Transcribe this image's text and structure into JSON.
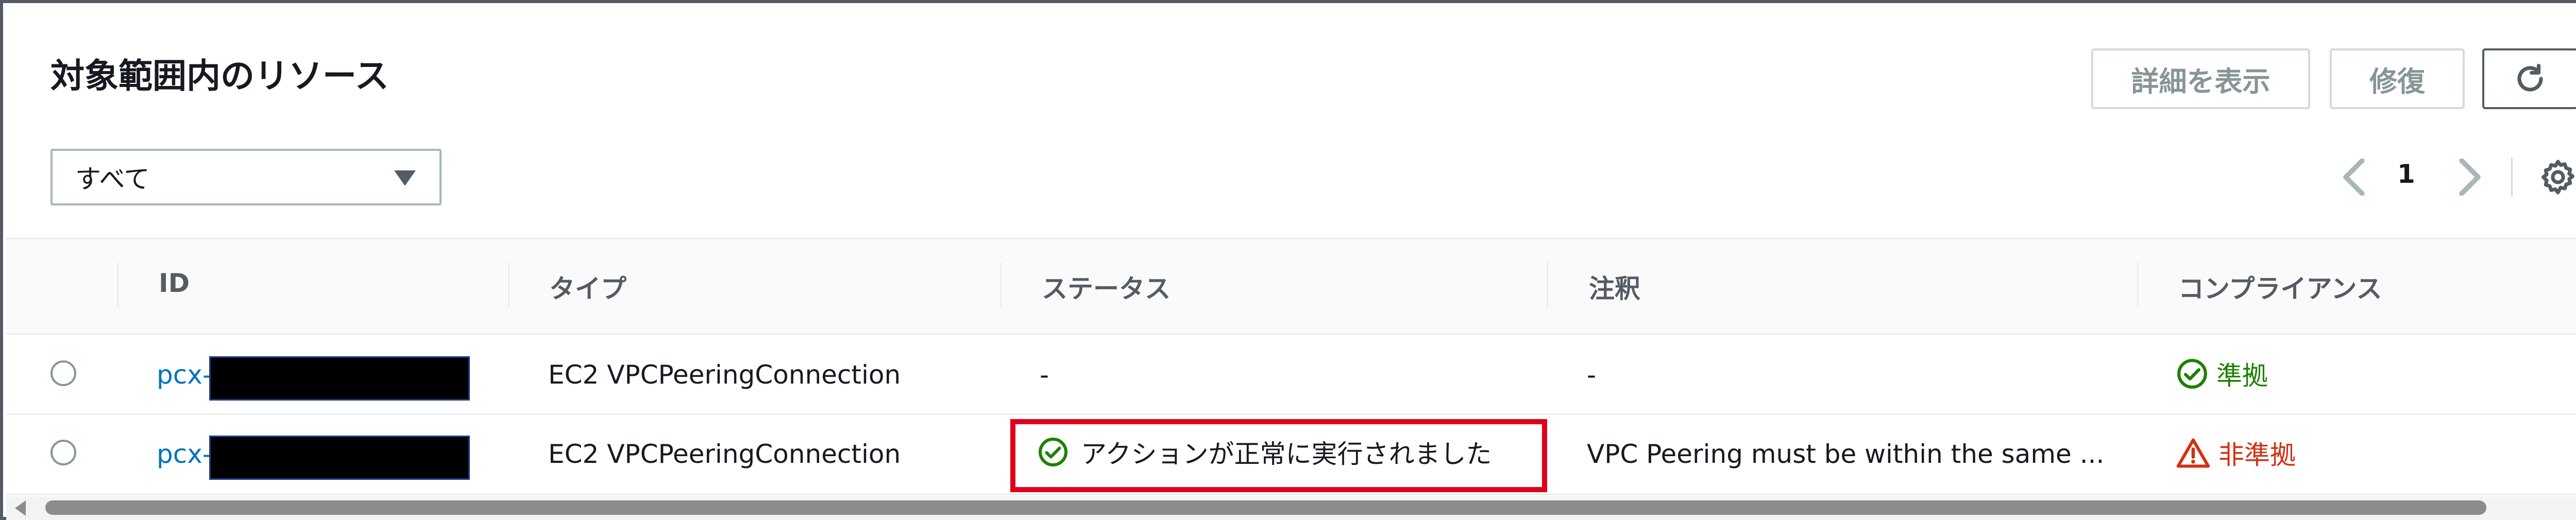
{
  "header": {
    "title": "対象範囲内のリソース",
    "details_button": "詳細を表示",
    "repair_button": "修復",
    "refresh_icon": "refresh-icon"
  },
  "filter": {
    "selected": "すべて",
    "caret_icon": "caret-down-icon"
  },
  "pagination": {
    "current_page": "1",
    "prev_icon": "chevron-left-icon",
    "next_icon": "chevron-right-icon",
    "settings_icon": "gear-icon"
  },
  "table": {
    "columns": [
      "ID",
      "タイプ",
      "ステータス",
      "注釈",
      "コンプライアンス"
    ],
    "rows": [
      {
        "id_prefix": "pcx-",
        "type": "EC2 VPCPeeringConnection",
        "status": "-",
        "annotation": "-",
        "compliance": "準拠"
      },
      {
        "id_prefix": "pcx-",
        "type": "EC2 VPCPeeringConnection",
        "status": "アクションが正常に実行されました",
        "annotation": "VPC Peering must be within the same ...",
        "compliance": "非準拠"
      }
    ]
  },
  "colors": {
    "link": "#0073bb",
    "compliant": "#1d8102",
    "noncompliant": "#d13212",
    "highlight": "#e0001b"
  }
}
